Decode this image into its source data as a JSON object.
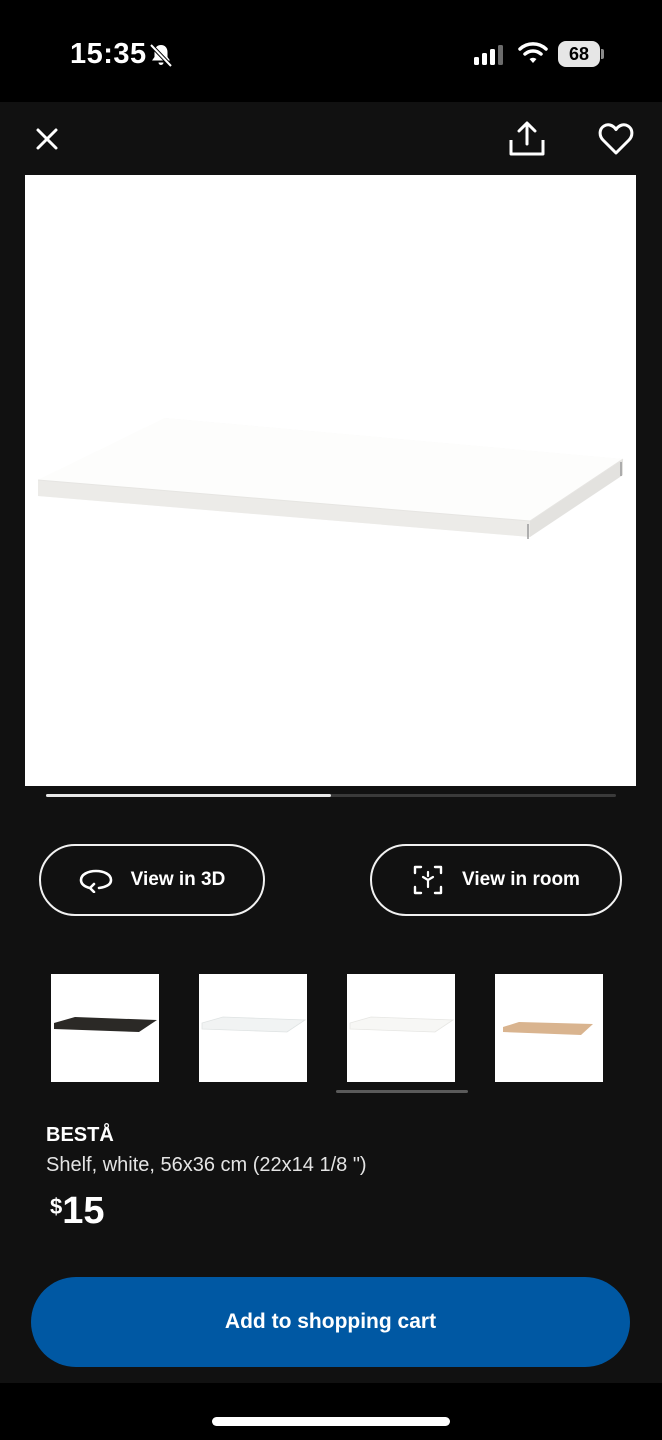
{
  "status_bar": {
    "time": "15:35",
    "battery": "68",
    "icons": [
      "bell-slash-icon",
      "signal-icon",
      "wifi-icon",
      "battery-icon"
    ]
  },
  "toolbar": {
    "icons": [
      "close-icon",
      "share-icon",
      "heart-icon"
    ]
  },
  "carousel": {
    "progress": 0.5
  },
  "actions": {
    "view_3d": "View in 3D",
    "view_room": "View in room",
    "view_3d_icon": "rotate-3d-icon",
    "view_room_icon": "ar-cube-icon"
  },
  "variants": [
    {
      "name": "black-brown",
      "color": "#2b2926",
      "selected": false
    },
    {
      "name": "glass",
      "color": "#f1f3f3",
      "selected": false
    },
    {
      "name": "white",
      "color": "#f7f7f5",
      "selected": true
    },
    {
      "name": "white-stained-oak",
      "color": "#d9b48f",
      "selected": false
    }
  ],
  "product": {
    "name": "BESTÅ",
    "description": "Shelf, white, 56x36 cm (22x14 1/8 \")",
    "currency": "$",
    "price": "15"
  },
  "cart": {
    "label": "Add to shopping cart"
  },
  "colors": {
    "accent": "#0058a3",
    "background": "#111111"
  }
}
